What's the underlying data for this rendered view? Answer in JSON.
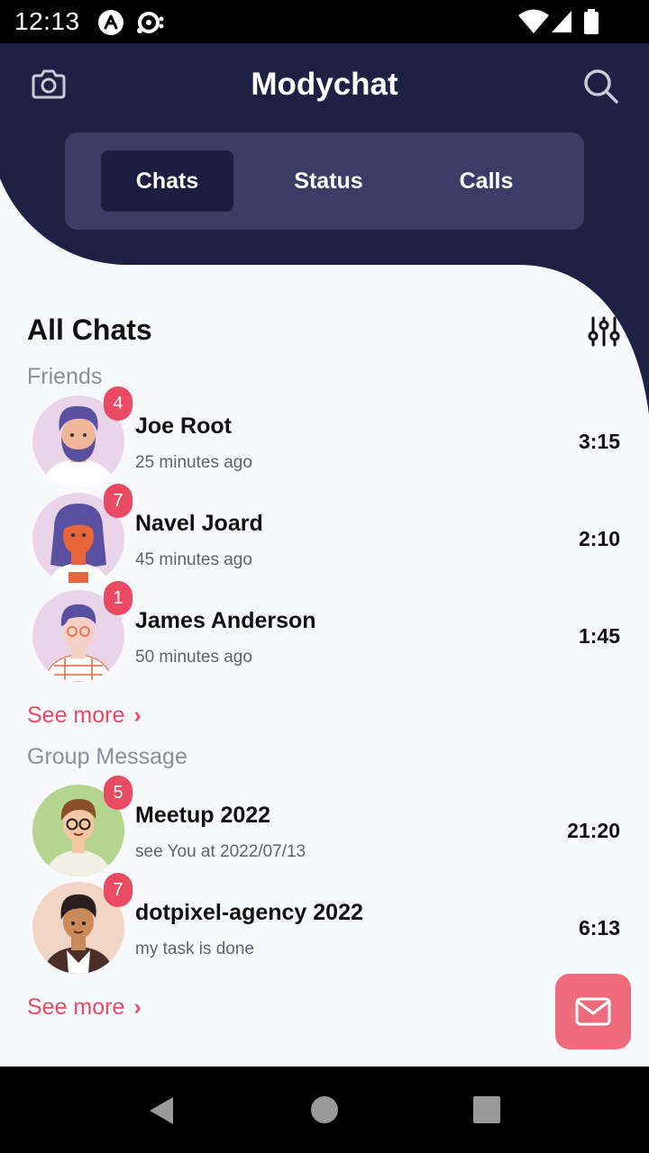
{
  "status_bar": {
    "time": "12:13"
  },
  "header": {
    "title": "Modychat"
  },
  "tabs": [
    {
      "label": "Chats",
      "active": true
    },
    {
      "label": "Status",
      "active": false
    },
    {
      "label": "Calls",
      "active": false
    }
  ],
  "main": {
    "title": "All Chats",
    "friends": {
      "label": "Friends",
      "see_more": "See more",
      "items": [
        {
          "name": "Joe Root",
          "subtitle": "25 minutes ago",
          "time": "3:15",
          "unread": "4"
        },
        {
          "name": "Navel Joard",
          "subtitle": "45 minutes ago",
          "time": "2:10",
          "unread": "7"
        },
        {
          "name": "James Anderson",
          "subtitle": "50 minutes ago",
          "time": "1:45",
          "unread": "1"
        }
      ]
    },
    "groups": {
      "label": "Group Message",
      "see_more": "See more",
      "items": [
        {
          "name": "Meetup 2022",
          "subtitle": "see You at 2022/07/13",
          "time": "21:20",
          "unread": "5"
        },
        {
          "name": "dotpixel-agency 2022",
          "subtitle": "my task is done",
          "time": "6:13",
          "unread": "7"
        }
      ]
    }
  },
  "icons": {
    "camera": "camera-icon",
    "search": "search-icon",
    "filter": "sliders-icon",
    "compose": "mail-icon",
    "chevron": "chevron-right-icon"
  },
  "colors": {
    "header_bg": "#1f2144",
    "tab_container": "#3c3d66",
    "tab_active": "#1b1e40",
    "accent": "#e84a62",
    "fab": "#ee6b7c",
    "page_bg": "#f7f9fc"
  }
}
